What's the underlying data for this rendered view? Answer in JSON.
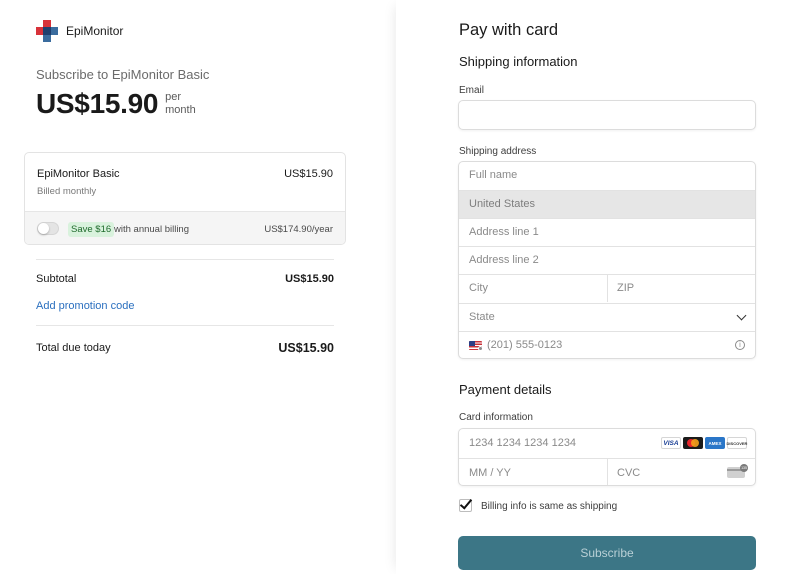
{
  "brand": {
    "name": "EpiMonitor"
  },
  "summary": {
    "subscribe_title": "Subscribe to EpiMonitor Basic",
    "price": "US$15.90",
    "per_line1": "per",
    "per_line2": "month"
  },
  "plan": {
    "name": "EpiMonitor Basic",
    "billed": "Billed monthly",
    "price": "US$15.90",
    "save_badge": "Save $16",
    "annual_text": "with annual billing",
    "annual_price": "US$174.90/year",
    "annual_toggle_on": false
  },
  "totals": {
    "subtotal_label": "Subtotal",
    "subtotal_value": "US$15.90",
    "promo_link": "Add promotion code",
    "total_label": "Total due today",
    "total_value": "US$15.90"
  },
  "form": {
    "title": "Pay with card",
    "shipping_title": "Shipping information",
    "email_label": "Email",
    "email_value": "",
    "shipping_address_label": "Shipping address",
    "full_name_placeholder": "Full name",
    "country": "United States",
    "address1_placeholder": "Address line 1",
    "address2_placeholder": "Address line 2",
    "city_placeholder": "City",
    "zip_placeholder": "ZIP",
    "state_placeholder": "State",
    "phone_placeholder": "(201) 555-0123",
    "payment_title": "Payment details",
    "card_info_label": "Card information",
    "card_number_placeholder": "1234 1234 1234 1234",
    "expiry_placeholder": "MM / YY",
    "cvc_placeholder": "CVC",
    "card_brands": [
      "VISA",
      "MC",
      "AMEX",
      "DISCOVER"
    ],
    "billing_same_label": "Billing info is same as shipping",
    "billing_same_checked": true,
    "subscribe_button": "Subscribe"
  },
  "colors": {
    "accent_link": "#2a6fbf",
    "button_bg": "#3c7686",
    "save_badge_bg": "#d9f2dd"
  }
}
